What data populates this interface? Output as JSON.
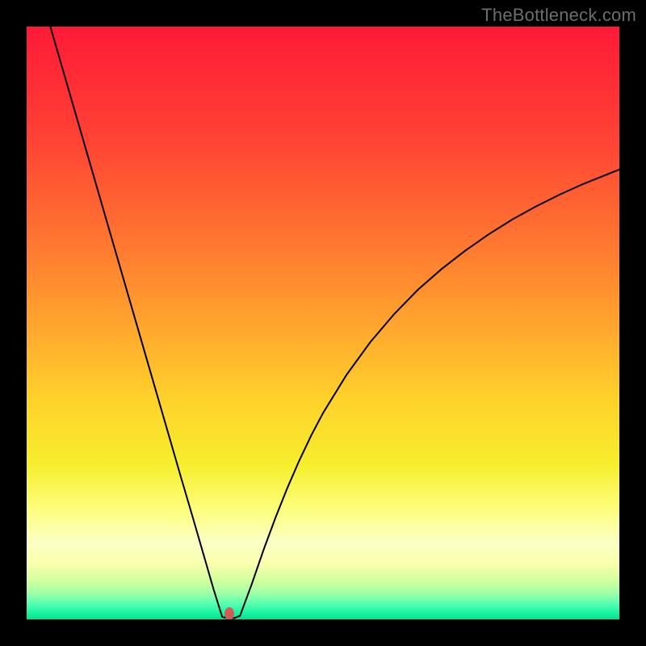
{
  "watermark": "TheBottleneck.com",
  "chart_data": {
    "type": "line",
    "title": "",
    "xlabel": "",
    "ylabel": "",
    "xlim": [
      0,
      100
    ],
    "ylim": [
      0,
      100
    ],
    "grid": false,
    "legend": false,
    "series": [
      {
        "name": "curve",
        "color": "#000000",
        "x": [
          4,
          6,
          8,
          10,
          12,
          14,
          16,
          18,
          20,
          22,
          24,
          26,
          28,
          30,
          31.5,
          33,
          34,
          35,
          36,
          38,
          40,
          42,
          44,
          46,
          48,
          50,
          54,
          58,
          62,
          66,
          70,
          74,
          78,
          82,
          86,
          90,
          94,
          98,
          100
        ],
        "y": [
          100,
          93.1,
          86.2,
          79.3,
          72.4,
          65.5,
          58.6,
          51.7,
          44.8,
          37.9,
          31.0,
          24.1,
          17.3,
          10.4,
          5.2,
          0.4,
          0.2,
          0.2,
          0.6,
          6.0,
          11.8,
          17.2,
          22.2,
          26.8,
          31.0,
          34.8,
          41.3,
          46.8,
          51.5,
          55.6,
          59.1,
          62.2,
          65.0,
          67.5,
          69.7,
          71.7,
          73.5,
          75.1,
          75.9
        ]
      }
    ],
    "marker": {
      "x": 34.2,
      "y": 0.9,
      "color": "#cf5d55"
    },
    "background_gradient": {
      "stops": [
        {
          "pos": 0.0,
          "color": "#ff1a37"
        },
        {
          "pos": 0.18,
          "color": "#ff4034"
        },
        {
          "pos": 0.34,
          "color": "#ff6f31"
        },
        {
          "pos": 0.5,
          "color": "#ffa42e"
        },
        {
          "pos": 0.63,
          "color": "#ffd22b"
        },
        {
          "pos": 0.74,
          "color": "#f6ee2d"
        },
        {
          "pos": 0.82,
          "color": "#fdff83"
        },
        {
          "pos": 0.87,
          "color": "#fcffc4"
        },
        {
          "pos": 0.905,
          "color": "#fbffad"
        },
        {
          "pos": 0.935,
          "color": "#d0ff9e"
        },
        {
          "pos": 0.955,
          "color": "#a2ffa7"
        },
        {
          "pos": 0.972,
          "color": "#5effb0"
        },
        {
          "pos": 0.986,
          "color": "#23f8a7"
        },
        {
          "pos": 1.0,
          "color": "#00e38e"
        }
      ]
    }
  }
}
